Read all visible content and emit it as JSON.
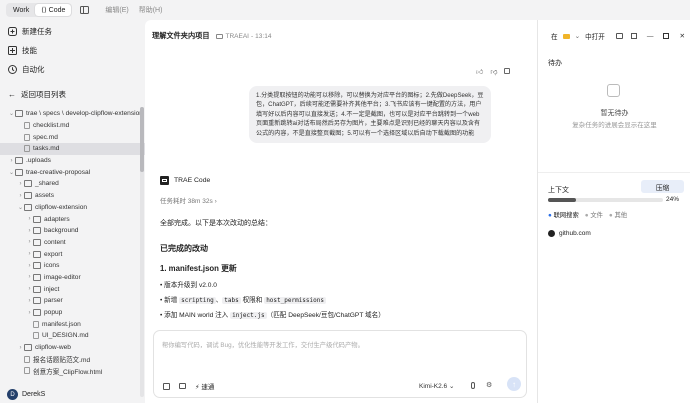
{
  "topbar": {
    "work_label": "Work",
    "code_label": "Code",
    "menu_edit": "编辑(E)",
    "menu_help": "帮助(H)"
  },
  "sidebar": {
    "new_task": "新建任务",
    "skills": "技能",
    "automation": "自动化",
    "back_label": "返回项目列表",
    "tree": [
      {
        "depth": 0,
        "type": "folder",
        "open": true,
        "label": "trae \\ specs \\ develop-clipflow-extension",
        "sel": false
      },
      {
        "depth": 1,
        "type": "file",
        "label": "checklist.md",
        "sel": false
      },
      {
        "depth": 1,
        "type": "file",
        "label": "spec.md",
        "sel": false
      },
      {
        "depth": 1,
        "type": "file",
        "label": "tasks.md",
        "sel": true
      },
      {
        "depth": 0,
        "type": "folder",
        "open": false,
        "label": ".uploads",
        "sel": false
      },
      {
        "depth": 0,
        "type": "folder",
        "open": true,
        "label": "trae-creative-proposal",
        "sel": false
      },
      {
        "depth": 1,
        "type": "folder",
        "open": false,
        "label": "_shared",
        "sel": false
      },
      {
        "depth": 1,
        "type": "folder",
        "open": false,
        "label": "assets",
        "sel": false
      },
      {
        "depth": 1,
        "type": "folder",
        "open": true,
        "label": "clipflow-extension",
        "sel": false
      },
      {
        "depth": 2,
        "type": "folder",
        "open": false,
        "label": "adapters",
        "sel": false
      },
      {
        "depth": 2,
        "type": "folder",
        "open": false,
        "label": "background",
        "sel": false
      },
      {
        "depth": 2,
        "type": "folder",
        "open": false,
        "label": "content",
        "sel": false
      },
      {
        "depth": 2,
        "type": "folder",
        "open": false,
        "label": "export",
        "sel": false
      },
      {
        "depth": 2,
        "type": "folder",
        "open": false,
        "label": "icons",
        "sel": false
      },
      {
        "depth": 2,
        "type": "folder",
        "open": false,
        "label": "image-editor",
        "sel": false
      },
      {
        "depth": 2,
        "type": "folder",
        "open": false,
        "label": "inject",
        "sel": false
      },
      {
        "depth": 2,
        "type": "folder",
        "open": false,
        "label": "parser",
        "sel": false
      },
      {
        "depth": 2,
        "type": "folder",
        "open": false,
        "label": "popup",
        "sel": false
      },
      {
        "depth": 2,
        "type": "file",
        "label": "manifest.json",
        "sel": false
      },
      {
        "depth": 2,
        "type": "file",
        "label": "UI_DESIGN.md",
        "sel": false
      },
      {
        "depth": 1,
        "type": "folder",
        "open": false,
        "label": "clipflow-web",
        "sel": false
      },
      {
        "depth": 1,
        "type": "file",
        "label": "报名话题贴范文.md",
        "sel": false
      },
      {
        "depth": 1,
        "type": "file",
        "label": "创意方案_ClipFlow.html",
        "sel": false
      }
    ],
    "user": "DerekS",
    "user_initial": "D"
  },
  "header": {
    "title": "理解文件夹内项目",
    "folder": "TRAEAI",
    "time": "13:14",
    "in_label": "在",
    "open_label": "中打开"
  },
  "chat": {
    "user_message": "1.分类提取按钮的功能可以移除，可以替换为对应平台的图标；2.先做DeepSeek，豆包，ChatGPT，后续可能还需要补齐其他平台；3.飞书应该有一键配置的方法，用户填写好以后内容可以直接发送；4.不一定是截图，也可以是对应平台跳转到一个web页面重新跳转ai对话布局然后另存为图片，主要难点是识别已经的聊天内容以及含有公式的内容，不是直接整页截图；5.可以有一个选择区域以后自动下载截图的功能",
    "agent_name": "TRAE Code",
    "duration": "任务耗时 38m 32s",
    "summary": "全部完成。以下是本次改动的总结：",
    "h_done": "已完成的改动",
    "h_manifest": "1. manifest.json 更新",
    "b1": "版本升级到 v2.0.0",
    "b2_pre": "新增 ",
    "b2_c1": "scripting",
    "b2_mid": "、",
    "b2_c2": "tabs",
    "b2_mid2": " 权限和 ",
    "b2_c3": "host_permissions",
    "b3_pre": "添加 MAIN world 注入 ",
    "b3_c": "inject.js",
    "b3_post": "（匹配 DeepSeek/豆包/ChatGPT 域名）"
  },
  "input": {
    "placeholder": "帮你编写代码，调试 Bug，优化性能等开发工作，交付生产级代码产物。",
    "mode": "速通",
    "model": "Kimi-K2.6"
  },
  "right": {
    "todo_title": "待办",
    "empty_title": "暂无待办",
    "empty_sub": "复杂任务的进展会显示在这里",
    "context_label": "上下文",
    "compress": "压缩",
    "percent": "24%",
    "percent_value": 24,
    "tabs": [
      "联网搜索",
      "文件",
      "其他"
    ],
    "link": "github.com"
  },
  "colors": {
    "accent": "#2b6fe8",
    "primary_btn": "#e8eef9"
  }
}
